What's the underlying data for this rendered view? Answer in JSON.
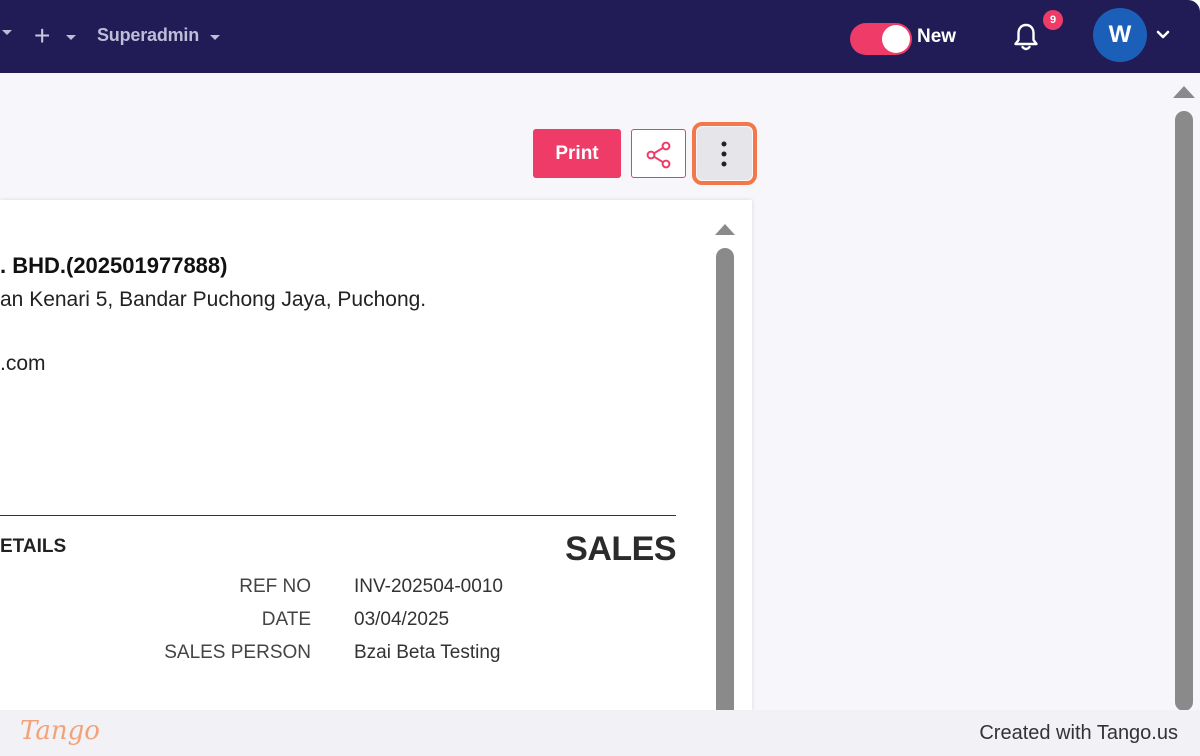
{
  "header": {
    "role_label": "Superadmin",
    "toggle_label": "New",
    "toggle_on": true,
    "notification_count": "9",
    "avatar_initial": "W",
    "accent_color": "#ee3b67",
    "bar_color": "#211c55"
  },
  "toolbar": {
    "print_label": "Print",
    "share_icon": "share-icon",
    "more_icon": "more-vertical-icon"
  },
  "invoice": {
    "company_name": ". BHD.(202501977888)",
    "company_address": "an Kenari 5, Bandar Puchong Jaya, Puchong.",
    "company_email": ".com",
    "details_title": "ETAILS",
    "doc_type": "SALES",
    "meta": [
      {
        "label": "REF NO",
        "value": "INV-202504-0010"
      },
      {
        "label": "DATE",
        "value": "03/04/2025"
      },
      {
        "label": "SALES PERSON",
        "value": "Bzai Beta Testing"
      }
    ]
  },
  "footer": {
    "logo_text": "Tango",
    "credit": "Created with Tango.us"
  }
}
